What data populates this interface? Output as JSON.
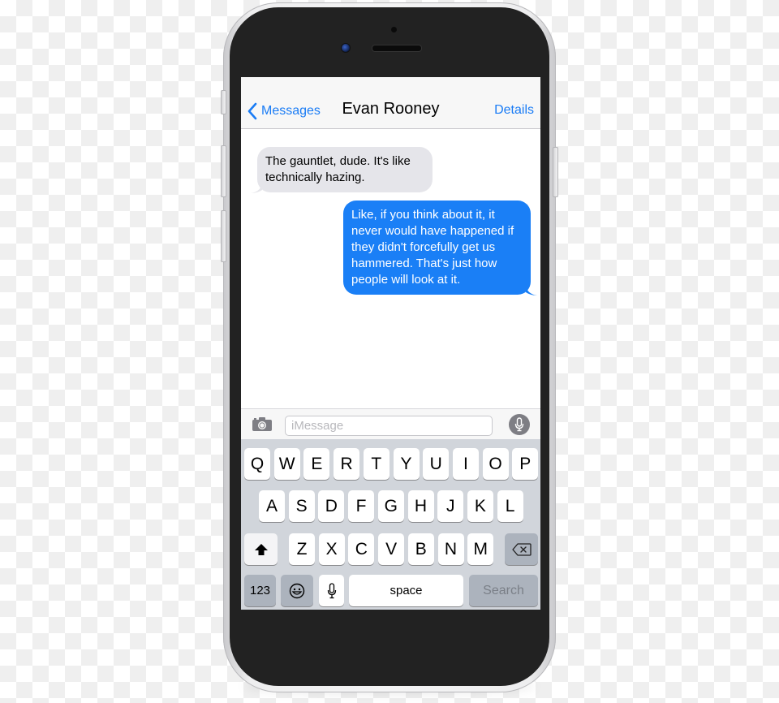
{
  "device": {
    "model": "iPhone",
    "frame_color": "#eeeeef",
    "bezel_color": "#222222"
  },
  "navbar": {
    "back_label": "Messages",
    "back_icon": "chevron-left-icon",
    "title": "Evan Rooney",
    "details_label": "Details",
    "accent_color": "#1a7cf5"
  },
  "messages": [
    {
      "direction": "incoming",
      "text": "The gauntlet, dude. It's like technically hazing.",
      "bubble_color": "#e5e5ea"
    },
    {
      "direction": "outgoing",
      "text": "Like, if you think about it, it never would have happened if they didn't forcefully get us hammered. That's just how people will look at it.",
      "bubble_color": "#1a7ff6"
    }
  ],
  "composer": {
    "camera_icon": "camera-icon",
    "placeholder": "iMessage",
    "value": "",
    "mic_icon": "microphone-icon"
  },
  "keyboard": {
    "row1": [
      "Q",
      "W",
      "E",
      "R",
      "T",
      "Y",
      "U",
      "I",
      "O",
      "P"
    ],
    "row2": [
      "A",
      "S",
      "D",
      "F",
      "G",
      "H",
      "J",
      "K",
      "L"
    ],
    "row3": [
      "Z",
      "X",
      "C",
      "V",
      "B",
      "N",
      "M"
    ],
    "shift_icon": "shift-icon",
    "delete_icon": "delete-icon",
    "numbers_label": "123",
    "emoji_icon": "emoji-icon",
    "dictation_icon": "microphone-icon",
    "space_label": "space",
    "search_label": "Search"
  }
}
